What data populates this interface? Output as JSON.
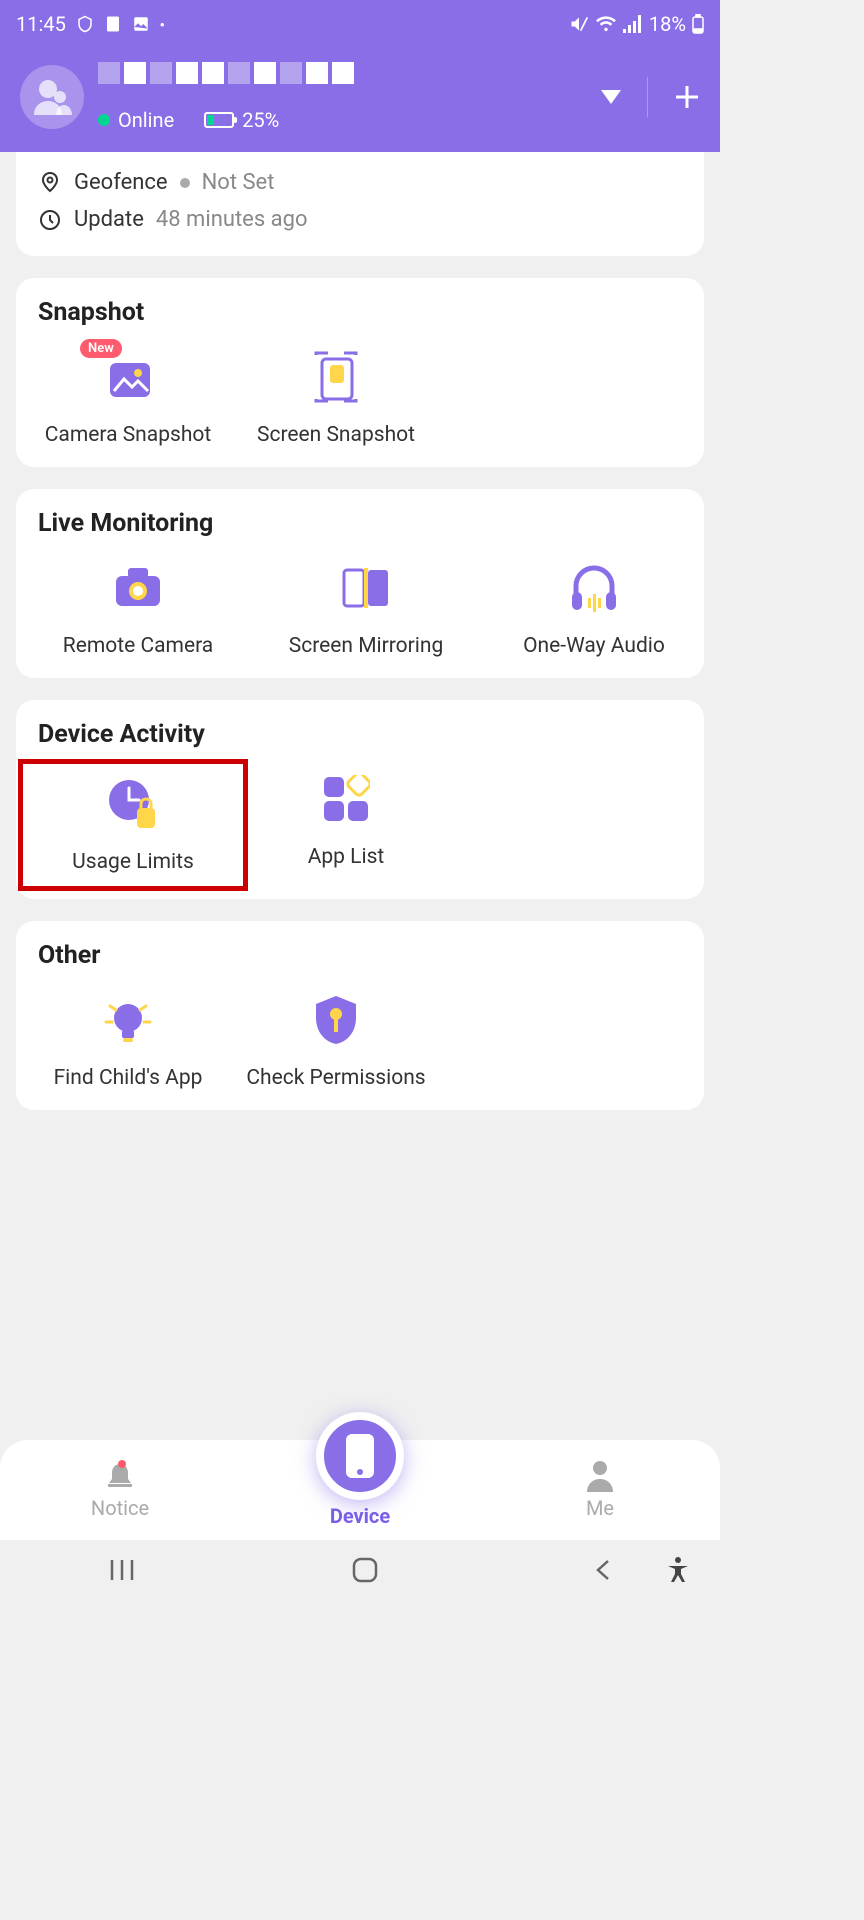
{
  "statusBar": {
    "time": "11:45",
    "batteryPercent": "18%"
  },
  "header": {
    "onlineStatus": "Online",
    "batteryLevel": "25%"
  },
  "infoCard": {
    "geofence": {
      "label": "Geofence",
      "value": "Not Set"
    },
    "update": {
      "label": "Update",
      "value": "48 minutes ago"
    }
  },
  "sections": {
    "snapshot": {
      "title": "Snapshot",
      "items": [
        {
          "label": "Camera Snapshot",
          "badge": "New"
        },
        {
          "label": "Screen Snapshot"
        }
      ]
    },
    "liveMonitoring": {
      "title": "Live Monitoring",
      "items": [
        {
          "label": "Remote Camera"
        },
        {
          "label": "Screen Mirroring"
        },
        {
          "label": "One-Way Audio"
        }
      ]
    },
    "deviceActivity": {
      "title": "Device Activity",
      "items": [
        {
          "label": "Usage Limits"
        },
        {
          "label": "App List"
        }
      ]
    },
    "other": {
      "title": "Other",
      "items": [
        {
          "label": "Find Child's App"
        },
        {
          "label": "Check Permissions"
        }
      ]
    }
  },
  "bottomNav": {
    "notice": "Notice",
    "device": "Device",
    "me": "Me"
  }
}
